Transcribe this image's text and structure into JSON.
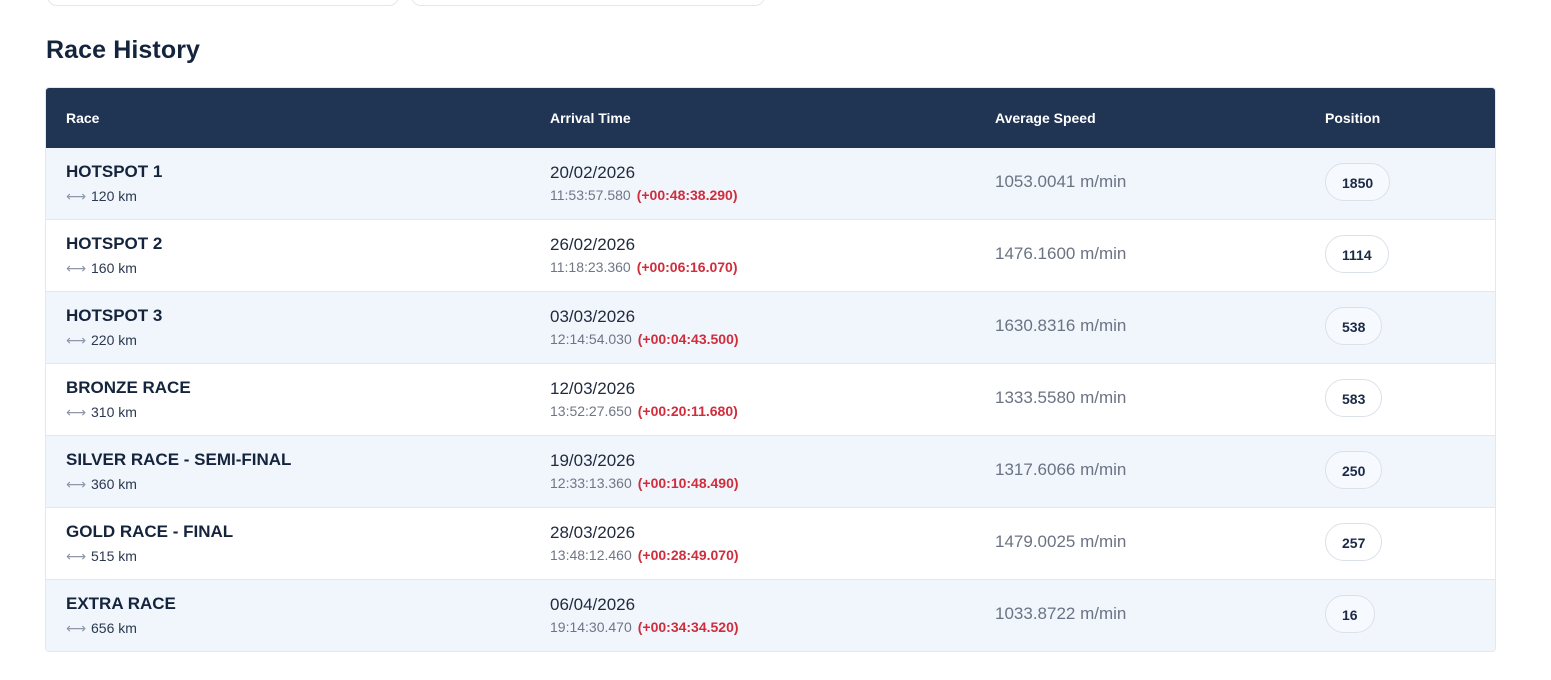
{
  "section_title": "Race History",
  "table": {
    "headers": {
      "race": "Race",
      "arrival_time": "Arrival Time",
      "average_speed": "Average Speed",
      "position": "Position"
    },
    "distance_icon": "horizontal-double-arrow-icon",
    "rows": [
      {
        "race": "HOTSPOT 1",
        "distance": "120 km",
        "date": "20/02/2026",
        "time": "11:53:57.580",
        "delta": "(+00:48:38.290)",
        "speed": "1053.0041 m/min",
        "position": "1850"
      },
      {
        "race": "HOTSPOT 2",
        "distance": "160 km",
        "date": "26/02/2026",
        "time": "11:18:23.360",
        "delta": "(+00:06:16.070)",
        "speed": "1476.1600 m/min",
        "position": "1114"
      },
      {
        "race": "HOTSPOT 3",
        "distance": "220 km",
        "date": "03/03/2026",
        "time": "12:14:54.030",
        "delta": "(+00:04:43.500)",
        "speed": "1630.8316 m/min",
        "position": "538"
      },
      {
        "race": "BRONZE RACE",
        "distance": "310 km",
        "date": "12/03/2026",
        "time": "13:52:27.650",
        "delta": "(+00:20:11.680)",
        "speed": "1333.5580 m/min",
        "position": "583"
      },
      {
        "race": "SILVER RACE - SEMI-FINAL",
        "distance": "360 km",
        "date": "19/03/2026",
        "time": "12:33:13.360",
        "delta": "(+00:10:48.490)",
        "speed": "1317.6066 m/min",
        "position": "250"
      },
      {
        "race": "GOLD RACE - FINAL",
        "distance": "515 km",
        "date": "28/03/2026",
        "time": "13:48:12.460",
        "delta": "(+00:28:49.070)",
        "speed": "1479.0025 m/min",
        "position": "257"
      },
      {
        "race": "EXTRA RACE",
        "distance": "656 km",
        "date": "06/04/2026",
        "time": "19:14:30.470",
        "delta": "(+00:34:34.520)",
        "speed": "1033.8722 m/min",
        "position": "16"
      }
    ]
  },
  "colors": {
    "header_bg": "#203453",
    "delta_red": "#d02d3c",
    "row_alt_bg": "#f1f6fd"
  }
}
